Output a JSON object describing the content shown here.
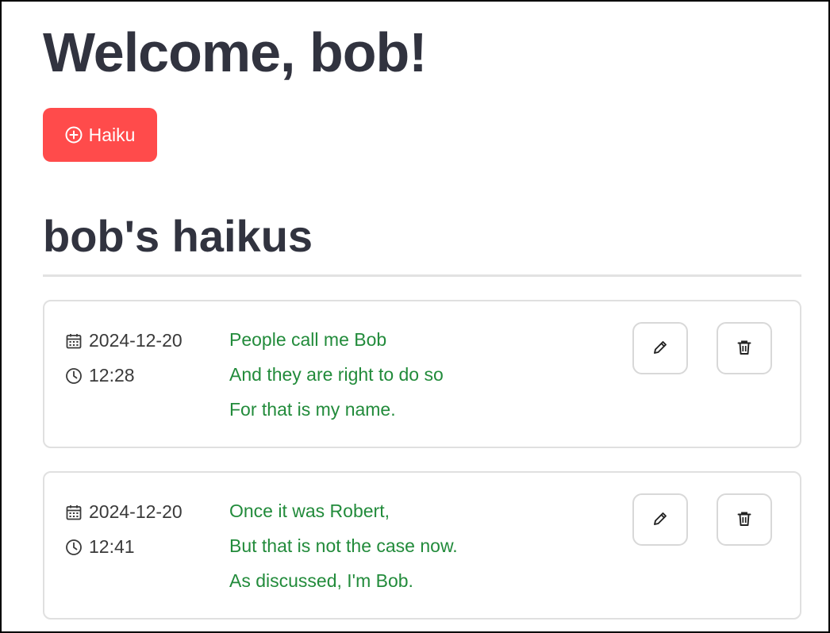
{
  "header": {
    "welcome_title": "Welcome, bob!",
    "new_haiku_label": "Haiku",
    "new_haiku_icon": "plus-circle-icon"
  },
  "section": {
    "title": "bob's haikus"
  },
  "haikus": [
    {
      "date": "2024-12-20",
      "time": "12:28",
      "lines": [
        "People call me Bob",
        "And they are right to do so",
        "For that is my name."
      ]
    },
    {
      "date": "2024-12-20",
      "time": "12:41",
      "lines": [
        "Once it was Robert,",
        "But that is not the case now.",
        "As discussed, I'm Bob."
      ]
    }
  ],
  "colors": {
    "primary_button": "#ff4b4b",
    "haiku_text": "#228b3b",
    "heading_text": "#31333f",
    "card_border": "#e0e0e0"
  },
  "icons": {
    "date": "calendar-icon",
    "time": "clock-icon",
    "edit": "pencil-icon",
    "delete": "trash-icon"
  }
}
